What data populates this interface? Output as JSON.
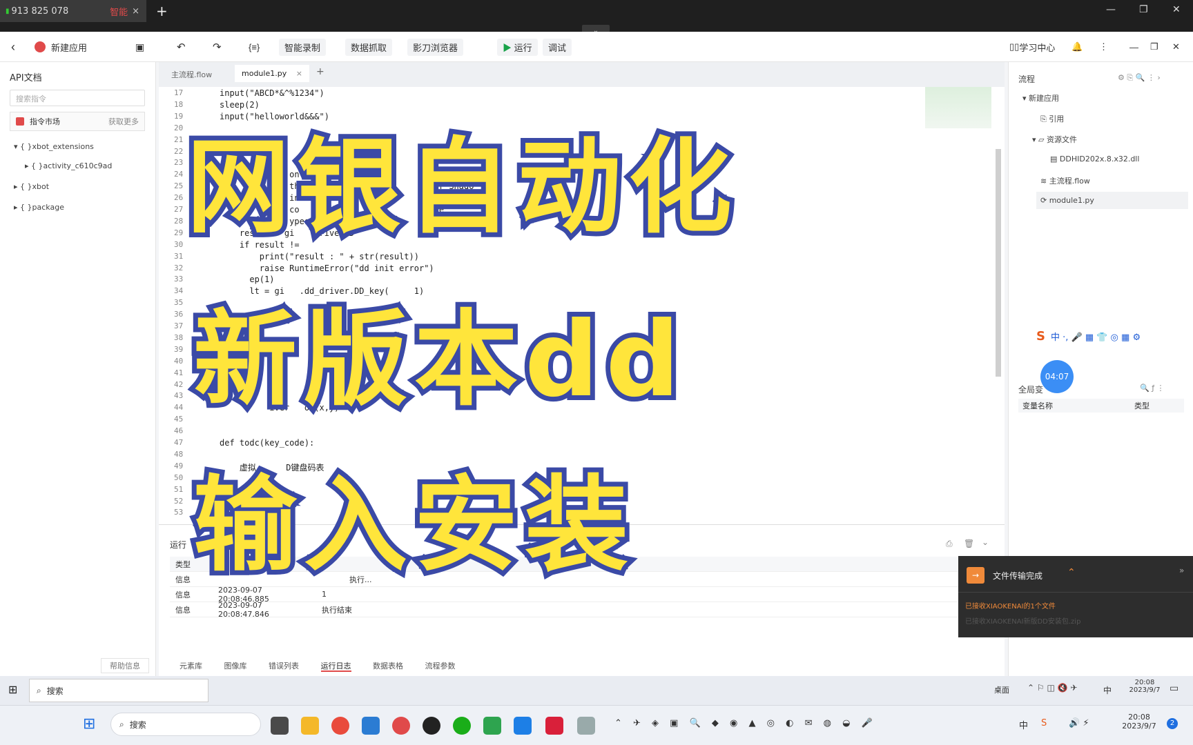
{
  "browser": {
    "tab_title": "913 825 078",
    "tab_badge": "智能",
    "tab_close": "×",
    "new_tab": "+",
    "min": "—",
    "restore": "❐",
    "close": "✕",
    "dropdown": "⌄"
  },
  "toolbar": {
    "back": "‹",
    "app_name": "新建应用",
    "smart_record": "智能录制",
    "data_grab": "数据抓取",
    "browser": "影刀浏览器",
    "run": "运行",
    "debug": "调试",
    "learn_center": "学习中心"
  },
  "left": {
    "title": "API文档",
    "search_placeholder": "搜索指令",
    "market": "指令市场",
    "get_more": "获取更多",
    "tree": [
      "{ }xbot_extensions",
      "{ }activity_c610c9ad",
      "{ }xbot",
      "{ }package"
    ],
    "help": "帮助信息"
  },
  "editor": {
    "tabs": [
      "主流程.flow",
      "module1.py"
    ],
    "tab_close": "×",
    "tab_add": "+",
    "lines": [
      {
        "n": "17",
        "t": "input(\"ABCD*&^%1234\")"
      },
      {
        "n": "18",
        "t": "sleep(2)"
      },
      {
        "n": "19",
        "t": "input(\"helloworld&&&\")"
      },
      {
        "n": "20",
        "t": ""
      },
      {
        "n": "21",
        "t": ""
      },
      {
        "n": "22",
        "t": ""
      },
      {
        "n": "23",
        "t": ""
      },
      {
        "n": "24",
        "t": "              on"
      },
      {
        "n": "25",
        "t": "              th.j                          r'Shado"
      },
      {
        "n": "26",
        "t": "              in"
      },
      {
        "n": "27",
        "t": "              co                         file_"
      },
      {
        "n": "28",
        "t": "              ypes.W                        me)"
      },
      {
        "n": "29",
        "t": "    resu     gi    driver.D"
      },
      {
        "n": "30",
        "t": "    if result !="
      },
      {
        "n": "31",
        "t": "        print(\"result : \" + str(result))"
      },
      {
        "n": "32",
        "t": "        raise RuntimeError(\"dd init error\")"
      },
      {
        "n": "33",
        "t": "      ep(1)"
      },
      {
        "n": "34",
        "t": "      lt = gi   .dd_driver.DD_key(     1)"
      },
      {
        "n": "35",
        "t": ""
      },
      {
        "n": "36",
        "t": "                     ive"
      },
      {
        "n": "37",
        "t": ""
      },
      {
        "n": "38",
        "t": ""
      },
      {
        "n": "39",
        "t": ""
      },
      {
        "n": "40",
        "t": ""
      },
      {
        "n": "41",
        "t": ""
      },
      {
        "n": "42",
        "t": ""
      },
      {
        "n": "43",
        "t": "           ib"
      },
      {
        "n": "44",
        "t": "          iver   ov(x,y)"
      },
      {
        "n": "45",
        "t": ""
      },
      {
        "n": "46",
        "t": ""
      },
      {
        "n": "47",
        "t": "def todc(key_code):"
      },
      {
        "n": "48",
        "t": ""
      },
      {
        "n": "49",
        "t": "    虚拟      D键盘码表"
      },
      {
        "n": "50",
        "t": ""
      },
      {
        "n": "51",
        "t": ""
      },
      {
        "n": "52",
        "t": ""
      },
      {
        "n": "53",
        "t": ""
      }
    ]
  },
  "output": {
    "title": "运行",
    "col_type": "类型",
    "rows": [
      {
        "type": "信息",
        "time": "",
        "msg": "执行..."
      },
      {
        "type": "信息",
        "time": "2023-09-07 20:08:46.885",
        "msg": "1"
      },
      {
        "type": "信息",
        "time": "2023-09-07 20:08:47.846",
        "msg": "执行结束"
      }
    ],
    "tabs": [
      "元素库",
      "图像库",
      "错误列表",
      "运行日志",
      "数据表格",
      "流程参数"
    ]
  },
  "right": {
    "title": "流程",
    "tree": [
      "新建应用",
      "引用",
      "资源文件",
      "DDHID202x.8.x32.dll",
      "主流程.flow",
      "module1.py"
    ],
    "globals": "全局变",
    "col_name": "变量名称",
    "col_type": "类型",
    "timer": "04:07"
  },
  "notify": {
    "title": "文件传输完成",
    "line1": "已接收XIAOKENAI的1个文件",
    "line2": "已接收XIAOKENAI新版DD安装包.zip"
  },
  "rtaskbar": {
    "search": "搜索",
    "desktop": "桌面",
    "ime": "中",
    "time": "20:08",
    "date": "2023/9/7"
  },
  "taskbar": {
    "search": "搜索",
    "ime": "中",
    "time": "20:08",
    "date": "2023/9/7",
    "notif_count": "2"
  },
  "overlay": {
    "line1": "网银自动化",
    "line2": "新版本dd",
    "line3": "输入安装"
  },
  "colors": {
    "overlay_fill": "#ffe53b",
    "overlay_stroke": "#3b4aa6",
    "run_green": "#1aa34a",
    "accent_red": "#e04a4a"
  }
}
